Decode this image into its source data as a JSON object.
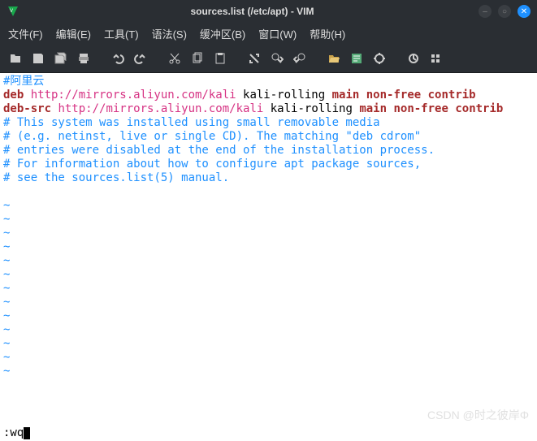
{
  "titlebar": {
    "title": "sources.list (/etc/apt) - VIM"
  },
  "menubar": {
    "items": [
      "文件(F)",
      "编辑(E)",
      "工具(T)",
      "语法(S)",
      "缓冲区(B)",
      "窗口(W)",
      "帮助(H)"
    ]
  },
  "toolbar_icons": [
    "open-icon",
    "save-icon",
    "saveall-icon",
    "print-icon",
    "sep",
    "undo-icon",
    "redo-icon",
    "sep",
    "cut-icon",
    "copy-icon",
    "paste-icon",
    "sep",
    "replace-icon",
    "findnext-icon",
    "findprev-icon",
    "sep",
    "session-icon",
    "script-icon",
    "make-icon",
    "sep",
    "shell-icon",
    "tags-icon"
  ],
  "file": {
    "lines": [
      {
        "segments": [
          {
            "cls": "c-comment",
            "text": "#阿里云"
          }
        ]
      },
      {
        "segments": [
          {
            "cls": "c-keyword",
            "text": "deb "
          },
          {
            "cls": "c-url",
            "text": "http://mirrors.aliyun.com/kali"
          },
          {
            "cls": "c-plain",
            "text": " kali-rolling "
          },
          {
            "cls": "c-repos",
            "text": "main non-free contrib"
          }
        ]
      },
      {
        "segments": [
          {
            "cls": "c-keyword",
            "text": "deb-src "
          },
          {
            "cls": "c-url",
            "text": "http://mirrors.aliyun.com/kali"
          },
          {
            "cls": "c-plain",
            "text": " kali-rolling "
          },
          {
            "cls": "c-repos",
            "text": "main non-free contrib"
          }
        ]
      },
      {
        "segments": [
          {
            "cls": "c-comment",
            "text": "# This system was installed using small removable media"
          }
        ]
      },
      {
        "segments": [
          {
            "cls": "c-comment",
            "text": "# (e.g. netinst, live or single CD). The matching \"deb cdrom\""
          }
        ]
      },
      {
        "segments": [
          {
            "cls": "c-comment",
            "text": "# entries were disabled at the end of the installation process."
          }
        ]
      },
      {
        "segments": [
          {
            "cls": "c-comment",
            "text": "# For information about how to configure apt package sources,"
          }
        ]
      },
      {
        "segments": [
          {
            "cls": "c-comment",
            "text": "# see the sources.list(5) manual."
          }
        ]
      }
    ],
    "tilde": "~",
    "tilde_count": 13
  },
  "cmdline": {
    "text": ":wq"
  },
  "watermark": "CSDN @时之彼岸Φ"
}
